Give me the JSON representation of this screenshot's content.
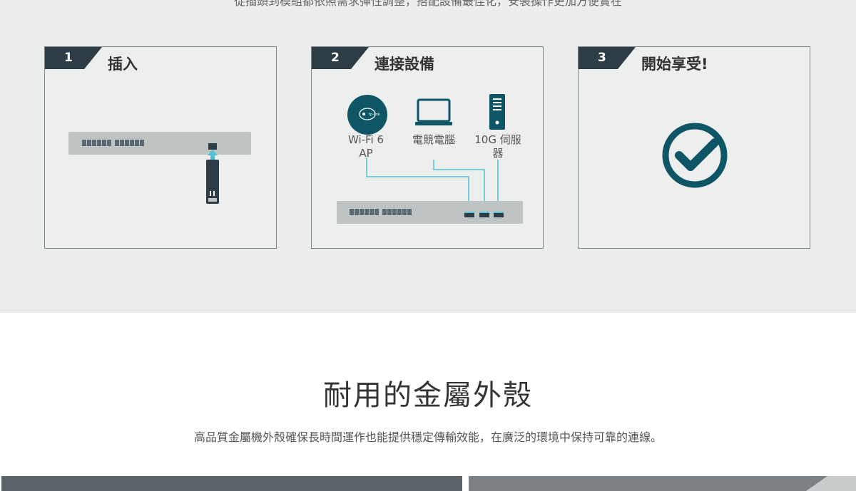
{
  "top_cut_text": "從插頭到模組都依照需求彈性調整，搭配設備最佳化，安裝操作更加方便實在",
  "steps": [
    {
      "number": "1",
      "title": "插入"
    },
    {
      "number": "2",
      "title": "連接設備"
    },
    {
      "number": "3",
      "title": "開始享受!"
    }
  ],
  "devices": {
    "ap_line1": "Wi-Fi 6",
    "ap_line2": "AP",
    "pc": "電競電腦",
    "server_line1": "10G 伺服",
    "server_line2": "器"
  },
  "section": {
    "heading": "耐用的金屬外殼",
    "description": "高品質金屬機外殼確保長時間運作也能提供穩定傳輸效能，在廣泛的環境中保持可靠的連線。"
  },
  "colors": {
    "dark": "#2e3d45",
    "teal": "#0e5566",
    "cyan": "#4fc3d4",
    "panel_bg": "#eceded"
  },
  "icons": [
    "arrow-up-icon",
    "access-point-icon",
    "laptop-icon",
    "server-icon",
    "checkmark-circle-icon"
  ]
}
